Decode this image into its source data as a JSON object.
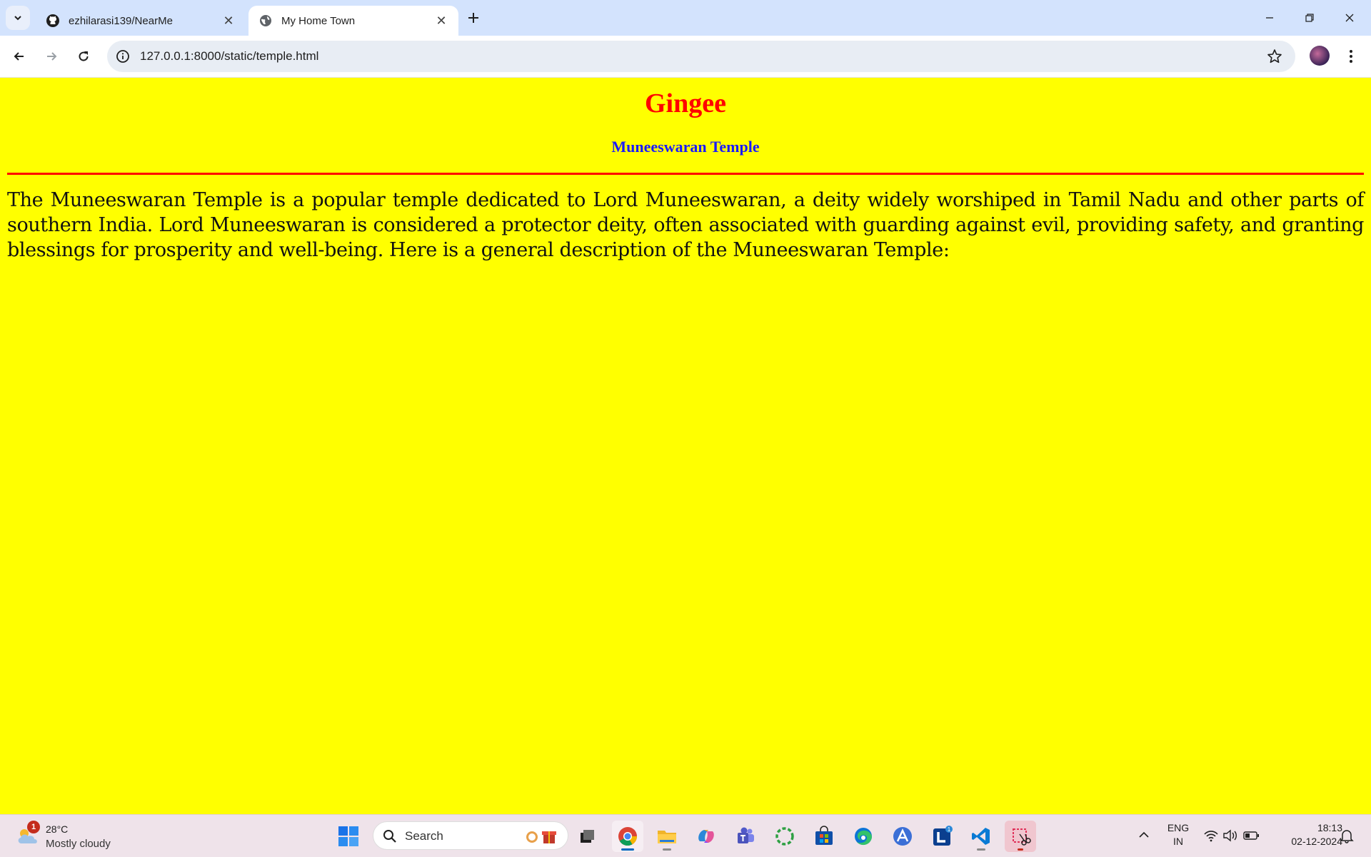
{
  "browser": {
    "tabs": [
      {
        "title": "ezhilarasi139/NearMe",
        "favicon": "github-icon",
        "active": false
      },
      {
        "title": "My Home Town",
        "favicon": "globe-icon",
        "active": true
      }
    ],
    "url": "127.0.0.1:8000/static/temple.html"
  },
  "page": {
    "title": "Gingee",
    "subtitle": "Muneeswaran Temple",
    "paragraph": "The Muneeswaran Temple is a popular temple dedicated to Lord Muneeswaran, a deity widely worshiped in Tamil Nadu and other parts of southern India. Lord Muneeswaran is considered a protector deity, often associated with guarding against evil, providing safety, and granting blessings for prosperity and well-being. Here is a general description of the Muneeswaran Temple:",
    "colors": {
      "background": "#ffff00",
      "title": "#ff0000",
      "subtitle": "#1a1aff",
      "rule": "#ff0000"
    }
  },
  "taskbar": {
    "weather": {
      "temperature": "28°C",
      "condition": "Mostly cloudy",
      "badge": "1"
    },
    "search_label": "Search",
    "apps": [
      {
        "name": "task-view-icon"
      },
      {
        "name": "chrome-icon"
      },
      {
        "name": "file-explorer-icon"
      },
      {
        "name": "copilot-icon"
      },
      {
        "name": "teams-icon"
      },
      {
        "name": "loader-app-icon"
      },
      {
        "name": "microsoft-store-icon"
      },
      {
        "name": "edge-icon"
      },
      {
        "name": "app-a-icon"
      },
      {
        "name": "app-l-icon",
        "badge": "1"
      },
      {
        "name": "vscode-icon"
      },
      {
        "name": "snipping-tool-icon"
      }
    ],
    "language": {
      "line1": "ENG",
      "line2": "IN"
    },
    "clock": {
      "time": "18:13",
      "date": "02-12-2024"
    }
  }
}
